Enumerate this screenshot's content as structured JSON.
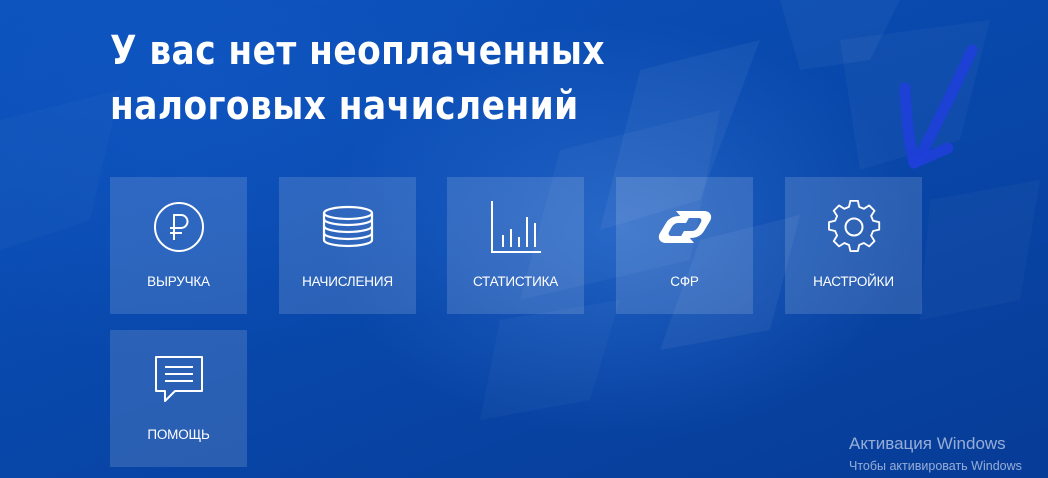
{
  "heading": "У вас нет неоплаченных налоговых начислений",
  "tiles": [
    {
      "label": "ВЫРУЧКА",
      "icon": "ruble-circle-icon"
    },
    {
      "label": "НАЧИСЛЕНИЯ",
      "icon": "coin-stack-icon"
    },
    {
      "label": "СТАТИСТИКА",
      "icon": "bar-chart-icon"
    },
    {
      "label": "СФР",
      "icon": "sfr-logo-icon"
    },
    {
      "label": "НАСТРОЙКИ",
      "icon": "gear-icon"
    },
    {
      "label": "ПОМОЩЬ",
      "icon": "message-icon"
    }
  ],
  "watermark": {
    "title": "Активация Windows",
    "subtitle": "Чтобы активировать Windows"
  },
  "colors": {
    "background": "#0a4bb0",
    "tile": "rgba(255,255,255,0.14)",
    "text": "#ffffff",
    "annotation_arrow": "#1e3fd8"
  }
}
